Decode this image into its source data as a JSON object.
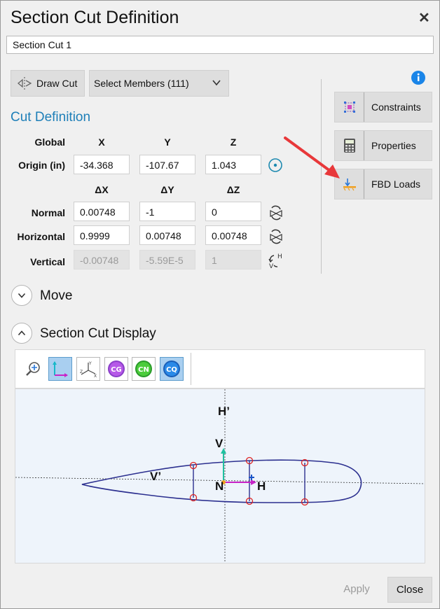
{
  "window": {
    "title": "Section Cut Definition",
    "close_label": "✕"
  },
  "cut_name": "Section Cut 1",
  "toolbar": {
    "draw_cut_label": "Draw Cut",
    "select_members_label": "Select Members (111)"
  },
  "cut_definition": {
    "heading": "Cut Definition",
    "global_label": "Global",
    "col_x": "X",
    "col_y": "Y",
    "col_z": "Z",
    "origin_label": "Origin  (in)",
    "origin": {
      "x": "-34.368",
      "y": "-107.67",
      "z": "1.043"
    },
    "col_dx": "ΔX",
    "col_dy": "ΔY",
    "col_dz": "ΔZ",
    "normal_label": "Normal",
    "normal": {
      "x": "0.00748",
      "y": "-1",
      "z": "0"
    },
    "horizontal_label": "Horizontal",
    "horizontal": {
      "x": "0.9999",
      "y": "0.00748",
      "z": "0.00748"
    },
    "vertical_label": "Vertical",
    "vertical": {
      "x": "-0.00748",
      "y": "-5.59E-5",
      "z": "1"
    }
  },
  "side_panel": {
    "constraints_label": "Constraints",
    "properties_label": "Properties",
    "fbd_loads_label": "FBD Loads",
    "info_icon": "info-icon"
  },
  "move": {
    "label": "Move"
  },
  "display": {
    "label": "Section Cut Display",
    "buttons": [
      "zoom-icon",
      "local-axes-icon",
      "global-axes-icon",
      "CG",
      "CN",
      "CQ"
    ],
    "cg_label": "CG",
    "cn_label": "CN",
    "cq_label": "CQ",
    "canvas": {
      "h_prime": "H’",
      "v_prime": "V’",
      "v": "V",
      "n": "N",
      "h": "H"
    }
  },
  "footer": {
    "apply_label": "Apply",
    "close_label": "Close"
  },
  "colors": {
    "accent": "#1e7fb8",
    "annotation_arrow": "#e8383a",
    "outline": "#2b2f8f",
    "marker": "#dd2222"
  }
}
